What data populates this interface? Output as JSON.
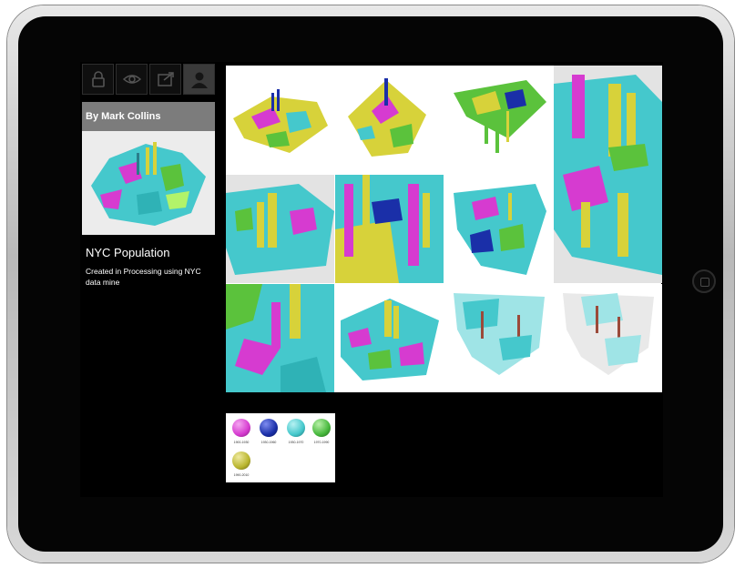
{
  "sidebar": {
    "toolbar": [
      {
        "icon": "lock-icon"
      },
      {
        "icon": "eye-icon"
      },
      {
        "icon": "share-icon"
      },
      {
        "icon": "profile-icon"
      }
    ],
    "author": "By Mark Collins",
    "project_title": "NYC Population",
    "project_description": "Created in Processing using NYC data mine"
  },
  "gallery": {
    "tiles": 12
  },
  "legend": {
    "items": [
      {
        "label": "1900-1930",
        "color": "#d63bd0"
      },
      {
        "label": "1930-1960",
        "color": "#1a2fa8"
      },
      {
        "label": "1930-1970",
        "color": "#45c8cc"
      },
      {
        "label": "1970-1990",
        "color": "#46b83c"
      },
      {
        "label": "1990-2010",
        "color": "#b9b52d"
      }
    ]
  },
  "colors": {
    "magenta": "#d63bd0",
    "cyan": "#45c8cc",
    "yellow": "#d7d23a",
    "green": "#5bc23c",
    "blue": "#1a2fa8"
  }
}
